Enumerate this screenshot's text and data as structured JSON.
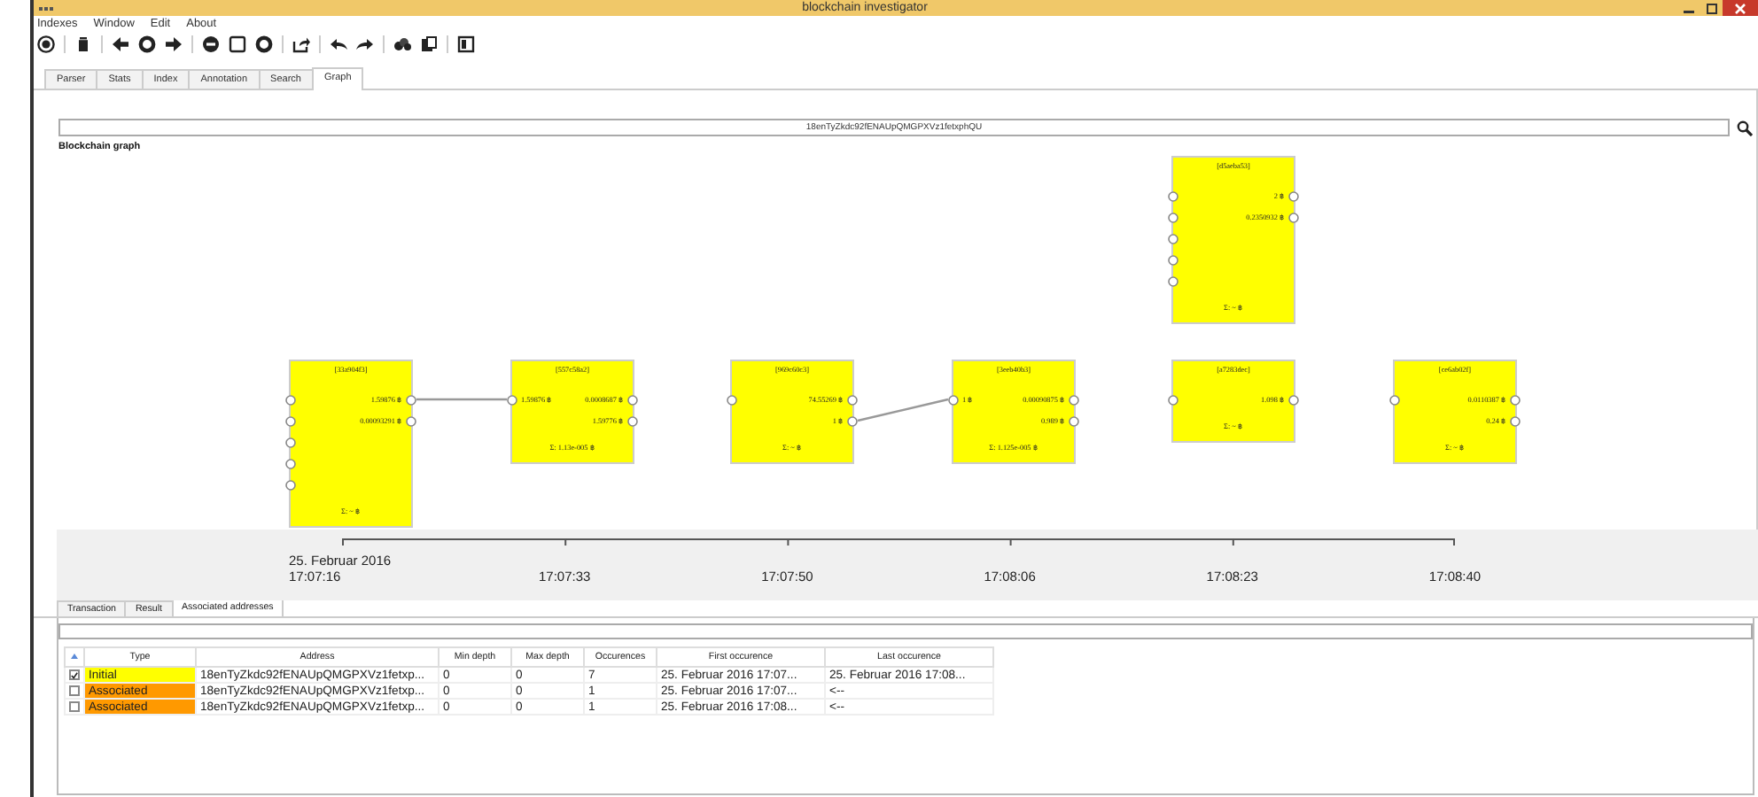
{
  "window": {
    "title": "blockchain investigator"
  },
  "menu": [
    "Indexes",
    "Window",
    "Edit",
    "About"
  ],
  "tabs": [
    {
      "label": "Parser",
      "selected": false
    },
    {
      "label": "Stats",
      "selected": false
    },
    {
      "label": "Index",
      "selected": false
    },
    {
      "label": "Annotation",
      "selected": false
    },
    {
      "label": "Search",
      "selected": false
    },
    {
      "label": "Graph",
      "selected": true
    }
  ],
  "address_field": {
    "value": "18enTyZkdc92fENAUpQMGPXVz1fetxphQU"
  },
  "graph": {
    "title": "Blockchain graph",
    "nodes": [
      {
        "id": "[d5aeba53]",
        "inputs": [
          {
            "kind": "open"
          },
          {
            "kind": "open"
          },
          {
            "kind": "open"
          },
          {
            "kind": "open"
          },
          {
            "kind": "open"
          }
        ],
        "outputs": [
          "2 ฿",
          "0.2350932 ฿"
        ],
        "sum": "Σ: ~ ฿"
      },
      {
        "id": "[33a904f3]",
        "inputs": [
          {
            "kind": "open"
          },
          {
            "kind": "open"
          },
          {
            "kind": "open"
          },
          {
            "kind": "open"
          },
          {
            "kind": "open"
          }
        ],
        "outputs": [
          "1.59876 ฿",
          "0.00093291 ฿"
        ],
        "sum": "Σ: ~ ฿"
      },
      {
        "id": "[557c58a2]",
        "inputs": [
          {
            "kind": "linked",
            "amount": "1.59876 ฿"
          }
        ],
        "outputs": [
          "0.0008687 ฿",
          "1.59776 ฿"
        ],
        "sum": "Σ: 1.13e-005 ฿"
      },
      {
        "id": "[969c60c3]",
        "inputs": [
          {
            "kind": "open"
          }
        ],
        "outputs": [
          "74.55269 ฿",
          "1 ฿"
        ],
        "sum": "Σ: ~ ฿"
      },
      {
        "id": "[3eeb40b3]",
        "inputs": [
          {
            "kind": "linked",
            "amount": "1 ฿"
          }
        ],
        "outputs": [
          "0.00090875 ฿",
          "0.989 ฿"
        ],
        "sum": "Σ: 1.125e-005 ฿"
      },
      {
        "id": "[a7283dec]",
        "inputs": [
          {
            "kind": "open"
          }
        ],
        "outputs": [
          "1.098 ฿"
        ],
        "sum": "Σ: ~ ฿"
      },
      {
        "id": "[ce6ab02f]",
        "inputs": [
          {
            "kind": "open"
          }
        ],
        "outputs": [
          "0.0110387 ฿",
          "0.24 ฿"
        ],
        "sum": "Σ: ~ ฿"
      }
    ]
  },
  "timeline": {
    "date": "25. Februar 2016",
    "ticks": [
      "17:07:16",
      "17:07:33",
      "17:07:50",
      "17:08:06",
      "17:08:23",
      "17:08:40"
    ]
  },
  "lower_tabs": [
    {
      "label": "Transaction",
      "selected": false
    },
    {
      "label": "Result",
      "selected": false
    },
    {
      "label": "Associated addresses",
      "selected": true
    }
  ],
  "table": {
    "columns": [
      "Type",
      "Address",
      "Min depth",
      "Max depth",
      "Occurences",
      "First occurence",
      "Last occurence"
    ],
    "rows": [
      {
        "checked": true,
        "type": "Initial",
        "color": "#ffff00",
        "address": "18enTyZkdc92fENAUpQMGPXVz1fetxp...",
        "min_depth": "0",
        "max_depth": "0",
        "occurences": "7",
        "first": "25. Februar 2016 17:07...",
        "last": "25. Februar 2016 17:08..."
      },
      {
        "checked": false,
        "type": "Associated",
        "color": "#ff9900",
        "address": "18enTyZkdc92fENAUpQMGPXVz1fetxp...",
        "min_depth": "0",
        "max_depth": "0",
        "occurences": "1",
        "first": "25. Februar 2016 17:07...",
        "last": "<--"
      },
      {
        "checked": false,
        "type": "Associated",
        "color": "#ff9900",
        "address": "18enTyZkdc92fENAUpQMGPXVz1fetxp...",
        "min_depth": "0",
        "max_depth": "0",
        "occurences": "1",
        "first": "25. Februar 2016 17:08...",
        "last": "<--"
      }
    ]
  }
}
